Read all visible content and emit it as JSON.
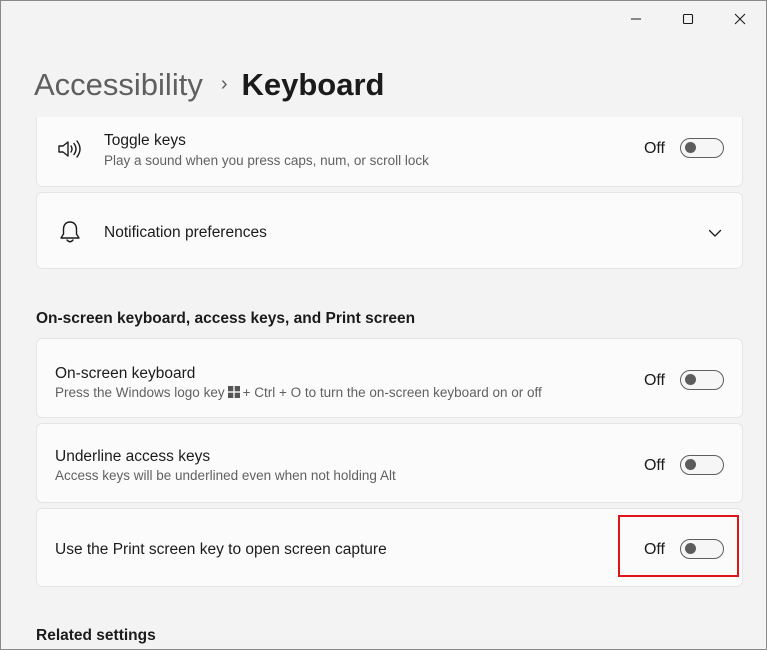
{
  "header": {
    "parent": "Accessibility",
    "separator": "›",
    "current": "Keyboard"
  },
  "settings_top": [
    {
      "title": "Toggle keys",
      "description": "Play a sound when you press caps, num, or scroll lock",
      "state": "Off",
      "icon": "speaker-icon"
    },
    {
      "title": "Notification preferences",
      "icon": "bell-icon",
      "chevron": "chevron-down-icon"
    }
  ],
  "section_onscreen": {
    "title": "On-screen keyboard, access keys, and Print screen",
    "items": [
      {
        "title": "On-screen keyboard",
        "description_before": "Press the Windows logo key",
        "description_after": "+ Ctrl + O to turn the on-screen keyboard on or off",
        "state": "Off"
      },
      {
        "title": "Underline access keys",
        "description": "Access keys will be underlined even when not holding Alt",
        "state": "Off"
      },
      {
        "title": "Use the Print screen key to open screen capture",
        "state": "Off"
      }
    ]
  },
  "section_related": {
    "title": "Related settings"
  },
  "colors": {
    "background": "#f3f3f3",
    "card": "#fbfbfb",
    "highlight": "#e0141b"
  }
}
